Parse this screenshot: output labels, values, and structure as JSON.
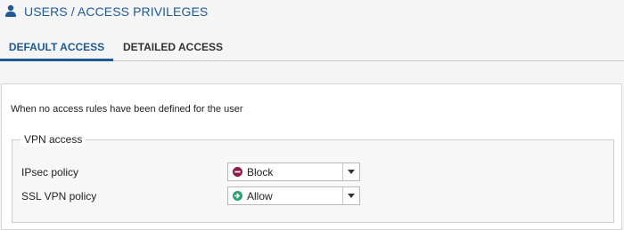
{
  "header": {
    "title": "USERS / ACCESS PRIVILEGES",
    "icon": "user-icon",
    "accent": "#1f5a96"
  },
  "tabs": [
    {
      "label": "DEFAULT ACCESS",
      "active": true
    },
    {
      "label": "DETAILED ACCESS",
      "active": false
    }
  ],
  "panel": {
    "intro": "When no access rules have been defined for the user",
    "vpn": {
      "legend": "VPN access",
      "ipsec": {
        "label": "IPsec policy",
        "value": "Block",
        "icon": "block-icon",
        "color": "#8e1a4e"
      },
      "ssl": {
        "label": "SSL VPN policy",
        "value": "Allow",
        "icon": "allow-icon",
        "color": "#2aa06b"
      }
    }
  }
}
